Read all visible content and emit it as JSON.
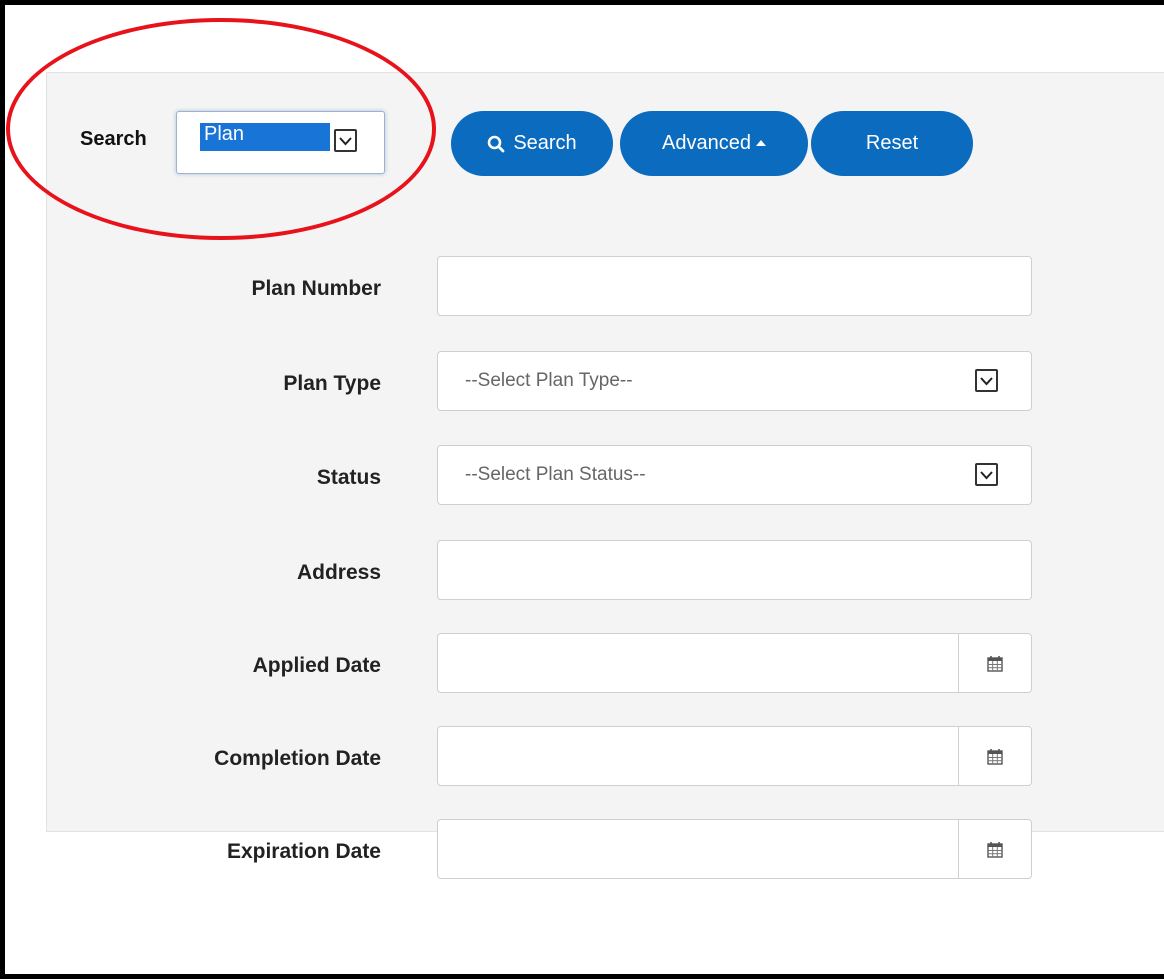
{
  "search": {
    "label": "Search",
    "mode_value": "Plan"
  },
  "buttons": {
    "search": "Search",
    "advanced": "Advanced",
    "reset": "Reset"
  },
  "fields": {
    "plan_number": {
      "label": "Plan Number",
      "value": ""
    },
    "plan_type": {
      "label": "Plan Type",
      "placeholder": "--Select Plan Type--"
    },
    "status": {
      "label": "Status",
      "placeholder": "--Select Plan Status--"
    },
    "address": {
      "label": "Address",
      "value": ""
    },
    "applied_date": {
      "label": "Applied Date",
      "value": ""
    },
    "completion_date": {
      "label": "Completion Date",
      "value": ""
    },
    "expiration_date": {
      "label": "Expiration Date",
      "value": ""
    }
  },
  "icons": {
    "search": "search-icon",
    "caret": "caret-up-icon",
    "dropdown": "chevron-down-icon",
    "calendar": "calendar-icon"
  },
  "colors": {
    "button_bg": "#0b6bbe",
    "selection_bg": "#1874d6",
    "annotation_circle": "#e8121b",
    "panel_bg": "#f4f4f4"
  }
}
